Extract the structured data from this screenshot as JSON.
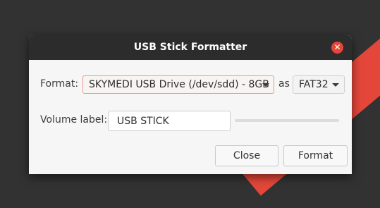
{
  "dialog": {
    "title": "USB Stick Formatter",
    "close_icon": "close-icon"
  },
  "format_row": {
    "label": "Format:",
    "device_selected": "SKYMEDI USB Drive (/dev/sdd) - 8GB",
    "as_label": "as",
    "filesystem_selected": "FAT32"
  },
  "volume_row": {
    "label": "Volume label:",
    "value": "USB STICK"
  },
  "progress": {
    "fraction": 0
  },
  "buttons": {
    "close_label": "Close",
    "format_label": "Format"
  },
  "colors": {
    "accent": "#e4473a",
    "titlebar": "#2c2c2c",
    "desktop": "#323232"
  }
}
